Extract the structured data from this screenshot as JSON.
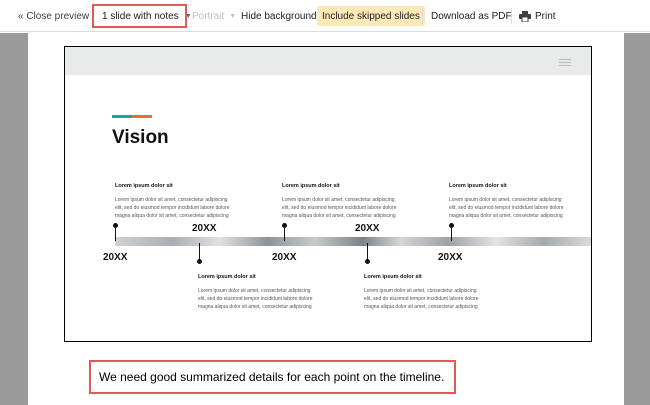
{
  "toolbar": {
    "close_label": "« Close preview",
    "layout_label": "1 slide with notes",
    "orientation_label": "Portrait",
    "hide_background_label": "Hide background",
    "include_skipped_label": "Include skipped slides",
    "download_label": "Download as PDF",
    "print_label": "Print"
  },
  "slide": {
    "title": "Vision",
    "milestones": [
      {
        "year": "20XX",
        "heading": "Lorem ipsum dolor sit",
        "lines": [
          "Lorem ipsum dolor sit amet, consectetur adipiscing",
          "elit, sed do eiusmod tempor incididunt labore dolore",
          "magna aliqua dolor sit amet, consectetur adipiscing"
        ]
      },
      {
        "year": "20XX",
        "heading": "Lorem ipsum dolor sit",
        "lines": [
          "Lorem ipsum dolor sit amet, consectetur adipiscing",
          "elit, sed do eiusmod tempor incididunt labore dolore",
          "magna aliqua dolor sit amet, consectetur adipiscing"
        ]
      },
      {
        "year": "20XX",
        "heading": "Lorem ipsum dolor sit",
        "lines": [
          "Lorem ipsum dolor sit amet, consectetur adipiscing",
          "elit, sed do eiusmod tempor incididunt labore dolore",
          "magna aliqua dolor sit amet, consectetur adipiscing"
        ]
      },
      {
        "year": "20XX",
        "heading": "Lorem ipsum dolor sit",
        "lines": [
          "Lorem ipsum dolor sit amet, consectetur adipiscing",
          "elit, sed do eiusmod tempor incididunt labore dolore",
          "magna aliqua dolor sit amet, consectetur adipiscing"
        ]
      },
      {
        "year": "20XX",
        "heading": "Lorem ipsum dolor sit",
        "lines": [
          "Lorem ipsum dolor sit amet, consectetur adipiscing",
          "elit, sed do eiusmod tempor incididunt labore dolore",
          "magna aliqua dolor sit amet, consectetur adipiscing"
        ]
      }
    ]
  },
  "notes": {
    "text": "We need good summarized details for each point on the timeline."
  },
  "colors": {
    "highlight_border": "#e05a5a",
    "skipped_highlight": "#fde9b8",
    "accent_teal": "#1aa596",
    "accent_orange": "#f06d22"
  }
}
